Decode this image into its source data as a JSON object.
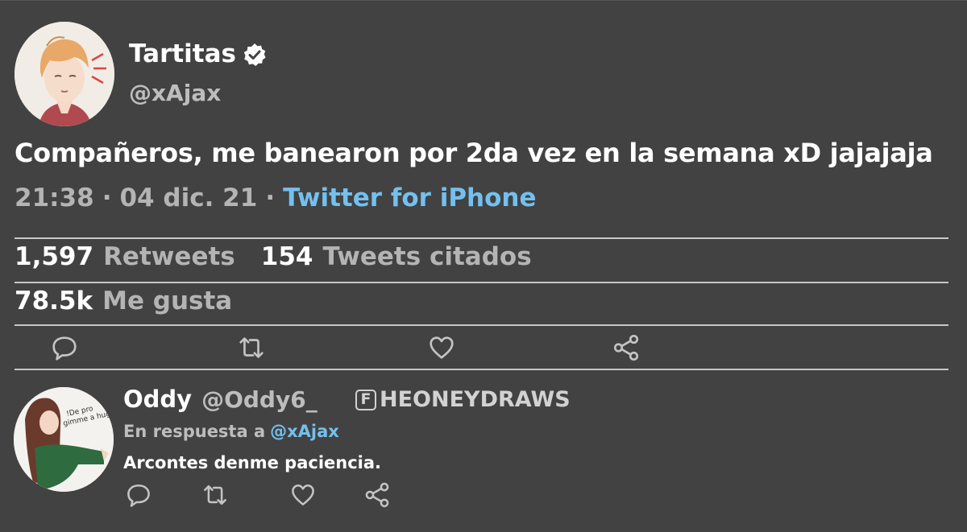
{
  "main_tweet": {
    "display_name": "Tartitas",
    "handle": "@xAjax",
    "verified_icon": "verified-badge-icon",
    "text": "Compañeros, me banearon por 2da vez en la semana xD jajajaja",
    "time": "21:38",
    "date": "04 dic. 21",
    "separator": "·",
    "source": "Twitter for iPhone",
    "stats": {
      "retweets_count": "1,597",
      "retweets_label": "Retweets",
      "quotes_count": "154",
      "quotes_label": "Tweets citados",
      "likes_count": "78.5k",
      "likes_label": "Me gusta"
    },
    "actions": [
      "reply-icon",
      "retweet-icon",
      "like-icon",
      "share-icon"
    ]
  },
  "reply_tweet": {
    "display_name": "Oddy",
    "handle": "@Oddy6_",
    "watermark_letter": "F",
    "watermark": "HEONEYDRAWS",
    "reply_prefix": "En respuesta a",
    "reply_mention": "@xAjax",
    "text": "Arcontes denme paciencia.",
    "actions": [
      "reply-icon",
      "retweet-icon",
      "like-icon",
      "share-icon"
    ]
  },
  "colors": {
    "background": "#424242",
    "text_primary": "#ffffff",
    "text_secondary": "#b4b4b4",
    "link": "#74c0ee",
    "divider": "#c8c8c8"
  }
}
